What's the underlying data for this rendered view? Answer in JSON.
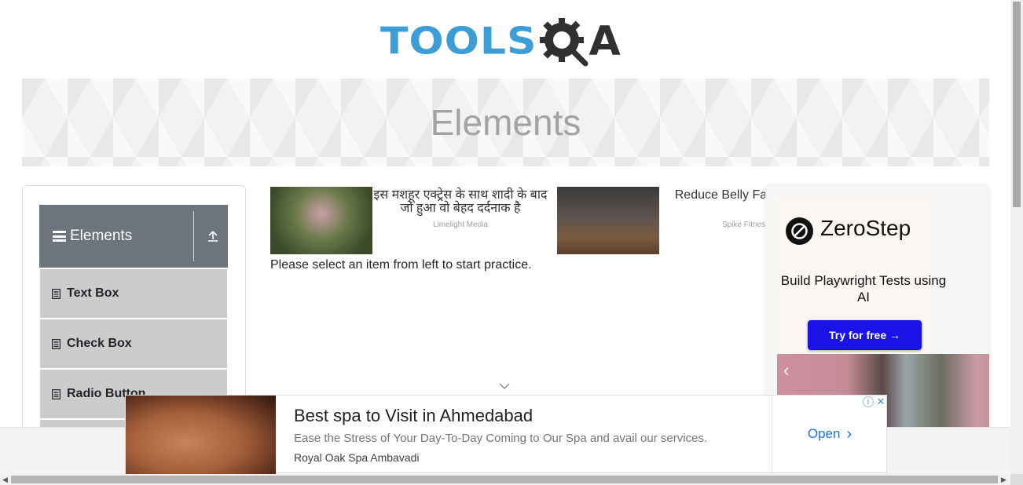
{
  "header": {
    "logo_text_left": "TOOLS",
    "logo_text_right": "A",
    "logo_icon": "gear-magnifier-icon"
  },
  "banner": {
    "title": "Elements"
  },
  "sidebar": {
    "group": {
      "label": "Elements",
      "menu_icon": "hamburger-icon",
      "collapse_icon": "upload-arrow-icon"
    },
    "items": [
      {
        "label": "Text Box",
        "icon": "document-icon"
      },
      {
        "label": "Check Box",
        "icon": "document-icon"
      },
      {
        "label": "Radio Button",
        "icon": "document-icon"
      }
    ]
  },
  "content": {
    "ads": [
      {
        "headline": "इस मशहूर एक्ट्रेस के साथ शादी के बाद जो हुआ वो बेहद दर्दनाक है",
        "source": "Limelight Media"
      },
      {
        "headline": "Reduce Belly Fat In Days",
        "source": "Spike Fitness"
      }
    ],
    "practice_text": "Please select an item from left to start practice."
  },
  "right_ad": {
    "brand": "ZeroStep",
    "tagline": "Build Playwright Tests using AI",
    "cta": "Try for free →"
  },
  "bottom_ad": {
    "title": "Best spa to Visit in Ahmedabad",
    "description": "Ease the Stress of Your Day-To-Day Coming to Our Spa and avail our services.",
    "advertiser": "Royal Oak Spa Ambavadi",
    "cta": "Open"
  },
  "colors": {
    "logo_blue": "#3d9dd6",
    "sidebar_header": "#6c757d",
    "sidebar_item": "#cccccc",
    "cta_blue": "#1a13e6",
    "link_blue": "#1a73e8"
  }
}
